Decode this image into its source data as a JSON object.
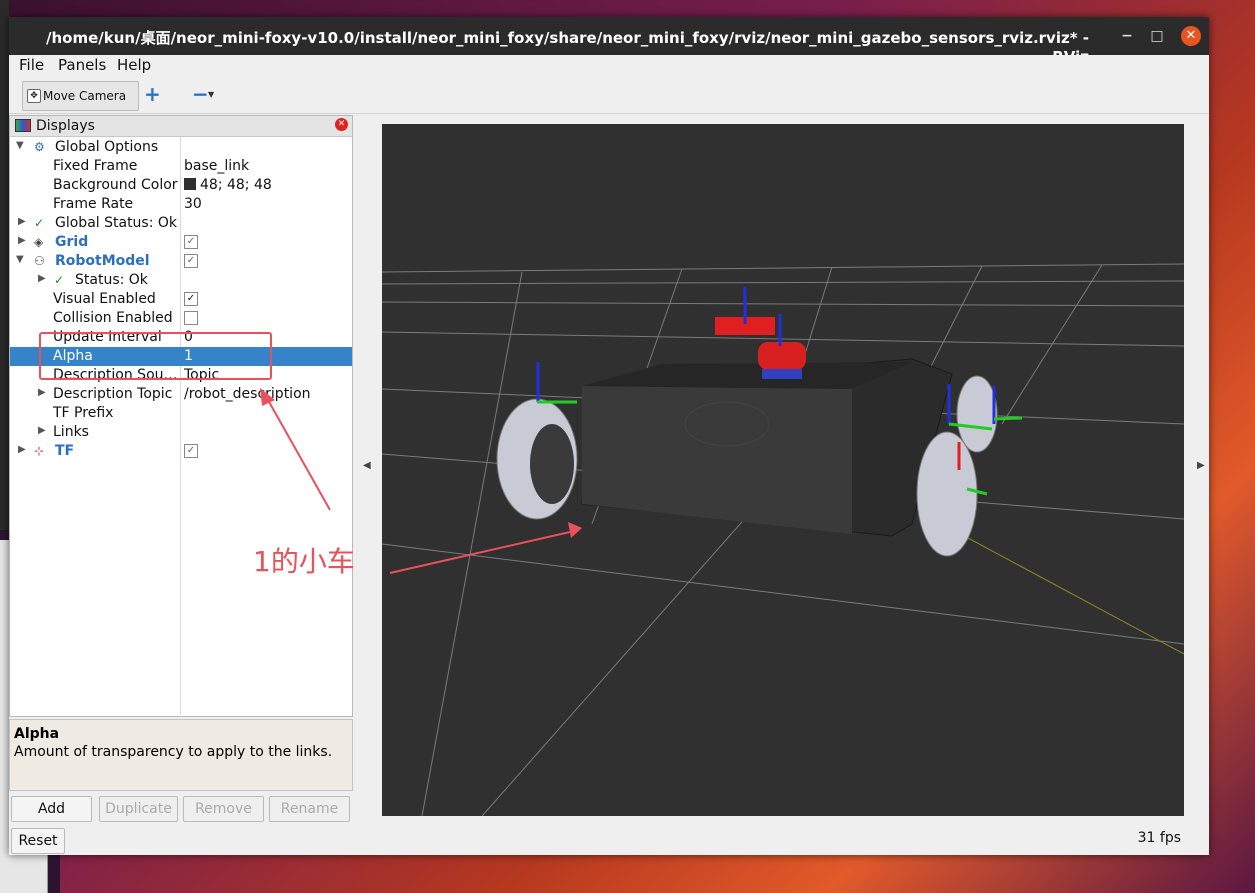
{
  "window": {
    "title": "/home/kun/桌面/neor_mini-foxy-v10.0/install/neor_mini_foxy/share/neor_mini_foxy/rviz/neor_mini_gazebo_sensors_rviz.rviz* - RViz",
    "minimize": "−",
    "maximize": "□",
    "close": "✕"
  },
  "menu": {
    "file": "File",
    "panels": "Panels",
    "help": "Help"
  },
  "toolbar": {
    "move_camera": "Move Camera",
    "add_tool": "+",
    "remove_tool": "−"
  },
  "displays": {
    "title": "Displays",
    "global_options": "Global Options",
    "fixed_frame_label": "Fixed Frame",
    "fixed_frame_value": "base_link",
    "background_color_label": "Background Color",
    "background_color_value": "48; 48; 48",
    "frame_rate_label": "Frame Rate",
    "frame_rate_value": "30",
    "global_status": "Global Status: Ok",
    "grid": "Grid",
    "robot_model": "RobotModel",
    "status": "Status: Ok",
    "visual_enabled": "Visual Enabled",
    "collision_enabled": "Collision Enabled",
    "update_interval_label": "Update Interval",
    "update_interval_value": "0",
    "alpha_label": "Alpha",
    "alpha_value": "1",
    "description_source_label": "Description Sou…",
    "description_source_value": "Topic",
    "description_topic_label": "Description Topic",
    "description_topic_value": "/robot_description",
    "tf_prefix": "TF Prefix",
    "links": "Links",
    "tf": "TF"
  },
  "help": {
    "title": "Alpha",
    "description": "Amount of transparency to apply to the links."
  },
  "buttons": {
    "add": "Add",
    "duplicate": "Duplicate",
    "remove": "Remove",
    "rename": "Rename",
    "reset": "Reset"
  },
  "viewport": {
    "fps": "31 fps",
    "background_color": "#303030"
  },
  "annotation": {
    "text": "1的小车"
  },
  "colors": {
    "selection": "#3584c9",
    "accent_blue": "#2b6fbf",
    "annotation_red": "#e8525b",
    "close_orange": "#e95420"
  }
}
